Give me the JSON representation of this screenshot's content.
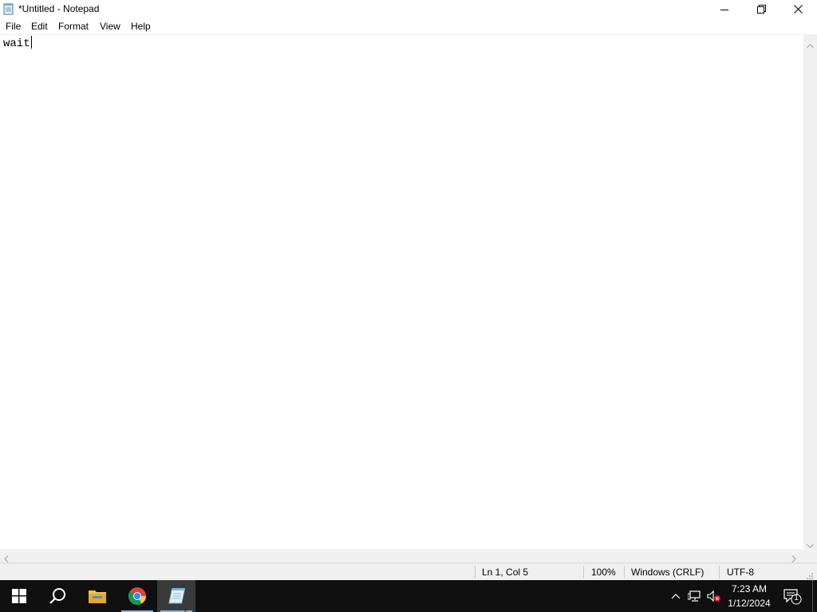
{
  "window": {
    "title": "*Untitled - Notepad",
    "icon": "notepad-icon"
  },
  "menu": {
    "items": [
      "File",
      "Edit",
      "Format",
      "View",
      "Help"
    ]
  },
  "editor": {
    "content": "wait"
  },
  "status": {
    "position": "Ln 1, Col 5",
    "zoom": "100%",
    "line_ending": "Windows (CRLF)",
    "encoding": "UTF-8"
  },
  "taskbar": {
    "apps": [
      "start-icon",
      "search-icon",
      "file-explorer-icon",
      "chrome-icon",
      "notepad-icon"
    ],
    "time": "7:23 AM",
    "date": "1/12/2024",
    "notification_count": "1"
  },
  "colors": {
    "taskbar_bg": "#101010",
    "active_indicator": "#76b9ed",
    "statusbar_bg": "#f0f0f0"
  }
}
